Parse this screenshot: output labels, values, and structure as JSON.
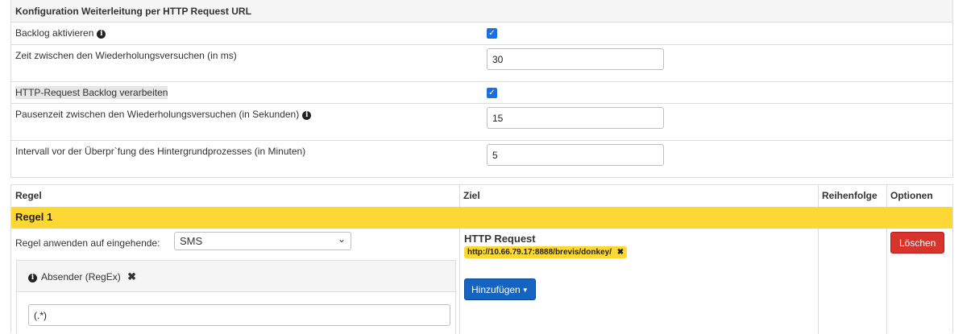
{
  "config": {
    "title": "Konfiguration Weiterleitung per HTTP Request URL",
    "backlog_label": "Backlog aktivieren",
    "backlog_checked": true,
    "retry_time_label": "Zeit zwischen den Wiederholungsversuchen (in ms)",
    "retry_time_value": "30",
    "process_backlog_label": "HTTP-Request Backlog verarbeiten",
    "process_backlog_checked": true,
    "pause_label": "Pausenzeit zwischen den Wiederholungsversuchen (in Sekunden)",
    "pause_value": "15",
    "interval_label": "Intervall vor der Überpr`fung des Hintergrundprozesses (in Minuten)",
    "interval_value": "5"
  },
  "rules": {
    "headers": {
      "rule": "Regel",
      "target": "Ziel",
      "order": "Reihenfolge",
      "options": "Optionen"
    },
    "rule1": {
      "title": "Regel 1",
      "apply_label": "Regel anwenden auf eingehende:",
      "apply_value": "SMS",
      "condition_label": "Absender (RegEx)",
      "condition_value": "(.*)",
      "target_type": "HTTP Request",
      "target_url": "http://10.66.79.17:8888/brevis/donkey/",
      "add_button": "Hinzufügen",
      "delete_button": "Löschen"
    }
  },
  "colors": {
    "highlight": "#fdd835",
    "primary": "#1565c0",
    "danger": "#d9342b",
    "checkbox": "#1a6fe5"
  }
}
